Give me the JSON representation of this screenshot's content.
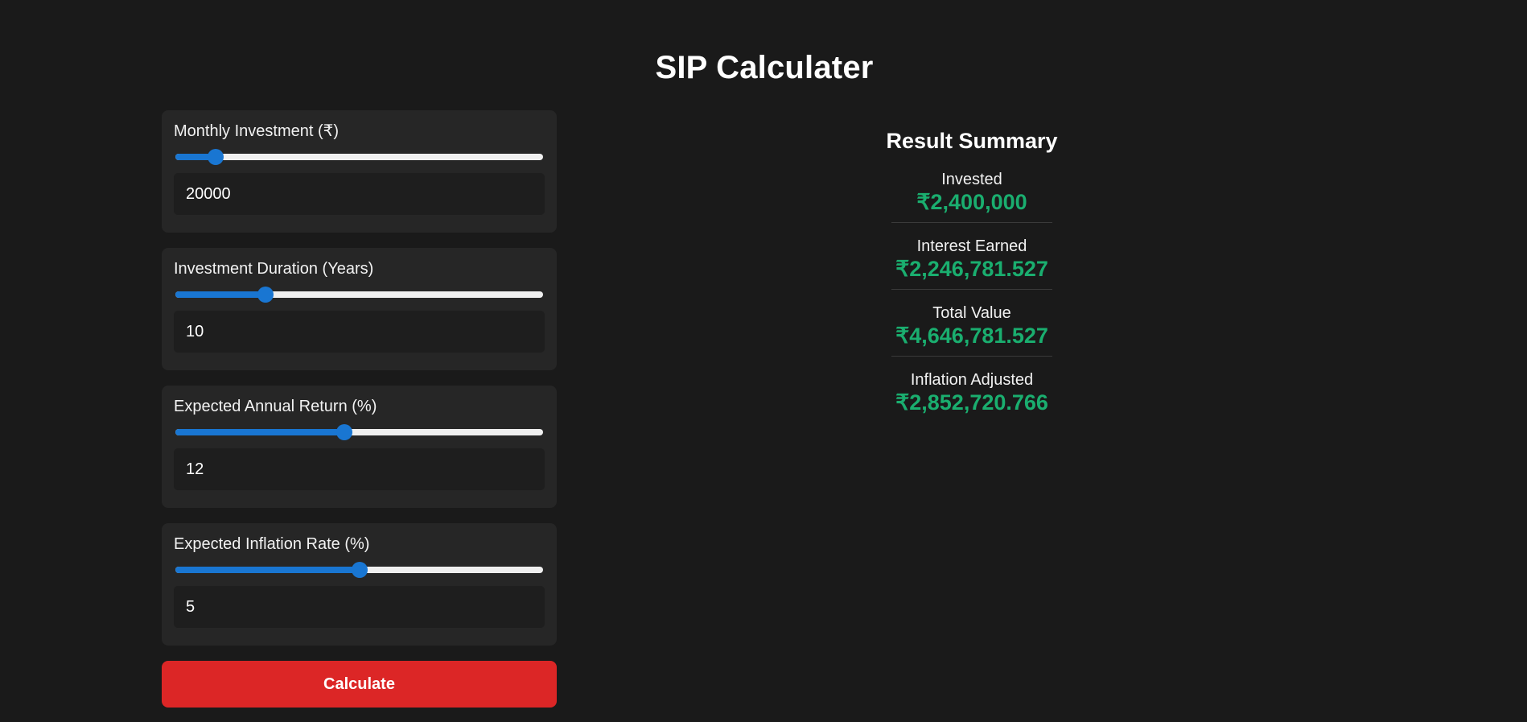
{
  "page": {
    "title": "SIP Calculater"
  },
  "inputs": [
    {
      "label": "Monthly Investment (₹)",
      "value": "20000",
      "slider_fraction": 0.11
    },
    {
      "label": "Investment Duration (Years)",
      "value": "10",
      "slider_fraction": 0.245
    },
    {
      "label": "Expected Annual Return (%)",
      "value": "12",
      "slider_fraction": 0.46
    },
    {
      "label": "Expected Inflation Rate (%)",
      "value": "5",
      "slider_fraction": 0.5
    }
  ],
  "calculate_button": {
    "label": "Calculate"
  },
  "summary": {
    "title": "Result Summary",
    "items": [
      {
        "label": "Invested",
        "value": "₹2,400,000"
      },
      {
        "label": "Interest Earned",
        "value": "₹2,246,781.527"
      },
      {
        "label": "Total Value",
        "value": "₹4,646,781.527"
      },
      {
        "label": "Inflation Adjusted",
        "value": "₹2,852,720.766"
      }
    ]
  },
  "colors": {
    "background": "#1a1a1a",
    "card": "#262626",
    "accent_blue": "#1976d2",
    "button_red": "#dc2626",
    "value_green": "#1aae6f"
  }
}
